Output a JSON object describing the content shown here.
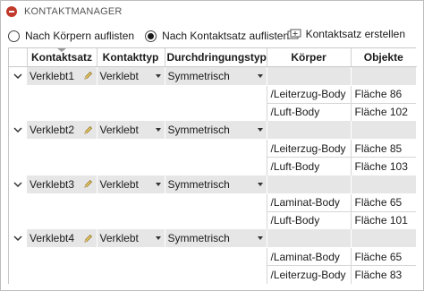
{
  "panel": {
    "title": "KONTAKTMANAGER"
  },
  "toolbar": {
    "radio_bodies": "Nach Körpern auflisten",
    "radio_contactset": "Nach Kontaktsatz auflisten",
    "create_button": "Kontaktsatz erstellen",
    "selected": "radio_contactset"
  },
  "table": {
    "headers": {
      "kontaktsatz": "Kontaktsatz",
      "kontakttyp": "Kontakttyp",
      "durchdringung": "Durchdringungstyp",
      "koerper": "Körper",
      "objekte": "Objekte"
    },
    "groups": [
      {
        "name": "Verklebt1",
        "typ": "Verklebt",
        "durch": "Symmetrisch",
        "rows": [
          {
            "body": "/Leiterzug-Body",
            "obj": "Fläche 86"
          },
          {
            "body": "/Luft-Body",
            "obj": "Fläche 102"
          }
        ]
      },
      {
        "name": "Verklebt2",
        "typ": "Verklebt",
        "durch": "Symmetrisch",
        "rows": [
          {
            "body": "/Leiterzug-Body",
            "obj": "Fläche 85"
          },
          {
            "body": "/Luft-Body",
            "obj": "Fläche 103"
          }
        ]
      },
      {
        "name": "Verklebt3",
        "typ": "Verklebt",
        "durch": "Symmetrisch",
        "rows": [
          {
            "body": "/Laminat-Body",
            "obj": "Fläche 65"
          },
          {
            "body": "/Luft-Body",
            "obj": "Fläche 101"
          }
        ]
      },
      {
        "name": "Verklebt4",
        "typ": "Verklebt",
        "durch": "Symmetrisch",
        "rows": [
          {
            "body": "/Laminat-Body",
            "obj": "Fläche 65"
          },
          {
            "body": "/Leiterzug-Body",
            "obj": "Fläche 83"
          }
        ]
      }
    ]
  }
}
